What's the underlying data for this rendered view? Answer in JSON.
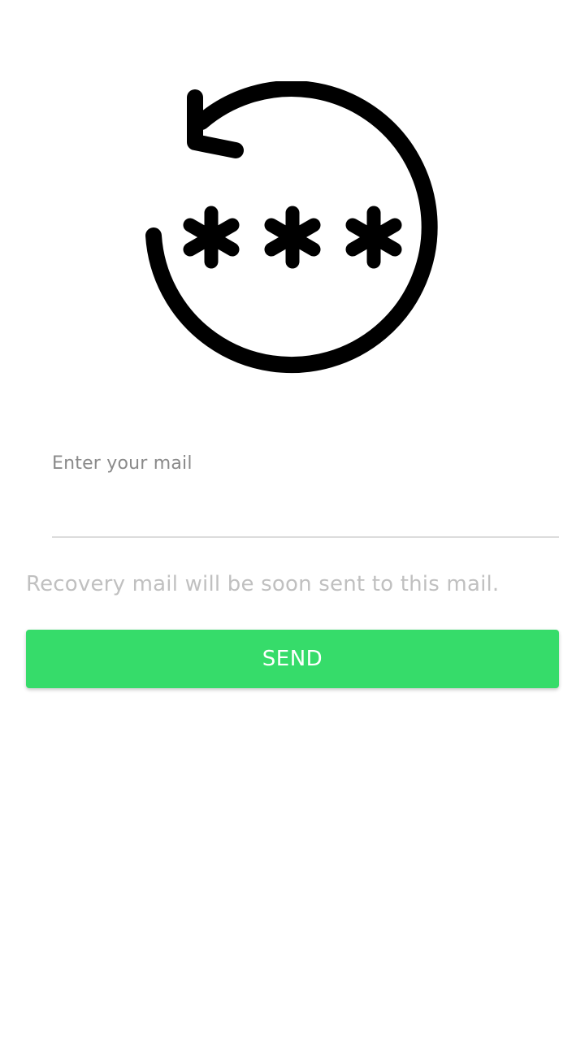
{
  "icons": {
    "hero": "password-reset-icon"
  },
  "form": {
    "email_label": "Enter your mail",
    "email_value": "",
    "hint": "Recovery mail will be soon sent to this mail.",
    "send_label": "SEND"
  },
  "colors": {
    "accent": "#36dc6a",
    "hint_text": "#c0c0c0",
    "label_text": "#8a8a8a",
    "underline": "#dcdcdc"
  }
}
